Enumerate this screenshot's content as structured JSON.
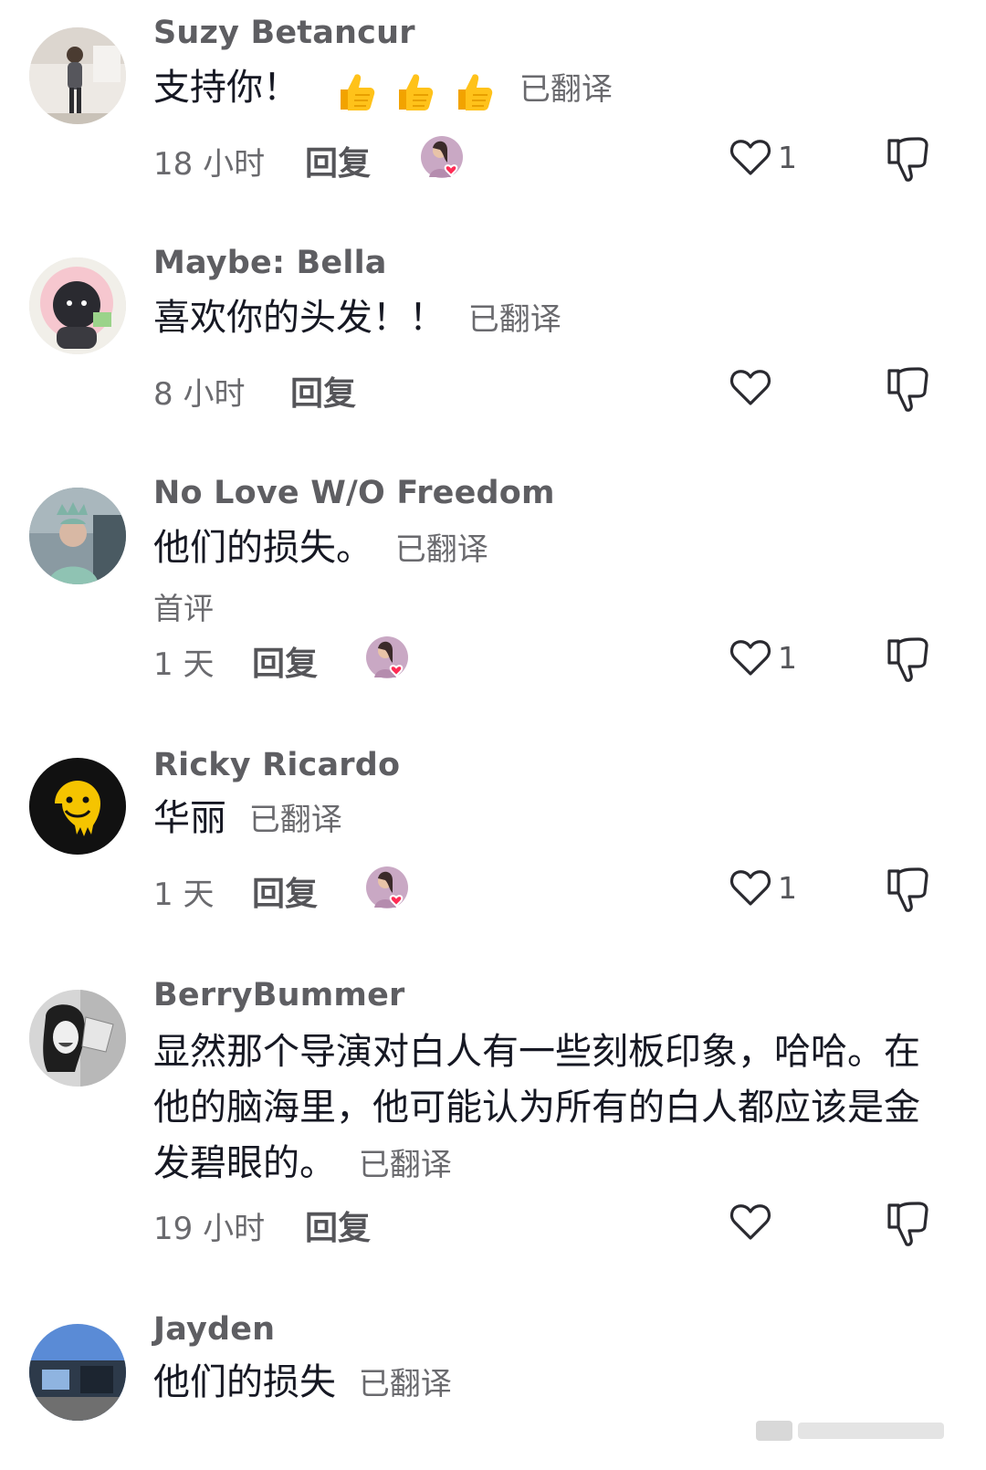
{
  "translated_label": "已翻译",
  "reply_label": "回复",
  "comments": [
    {
      "username": "Suzy Betancur",
      "text": "支持你！",
      "emoji": [
        "👍",
        "👍",
        "👍"
      ],
      "time": "18 小时",
      "likes": "1",
      "creator_liked": true
    },
    {
      "username": "Maybe: Bella",
      "text": "喜欢你的头发！！",
      "time": "8 小时",
      "likes": "",
      "creator_liked": false
    },
    {
      "username": "No Love W/O Freedom",
      "text": "他们的损失。",
      "tag": "首评",
      "time": "1 天",
      "likes": "1",
      "creator_liked": true
    },
    {
      "username": "Ricky Ricardo",
      "text": "华丽",
      "time": "1 天",
      "likes": "1",
      "creator_liked": true
    },
    {
      "username": "BerryBummer",
      "text": "显然那个导演对白人有一些刻板印象，哈哈。在他的脑海里，他可能认为所有的白人都应该是金发碧眼的。",
      "time": "19 小时",
      "likes": "",
      "creator_liked": false
    },
    {
      "username": "Jayden",
      "text": "他们的损失",
      "time": "",
      "likes": "",
      "creator_liked": false
    }
  ],
  "colors": {
    "heart_badge": "#fe2c55",
    "text_primary": "#161823",
    "text_secondary": "#6a6a6e"
  }
}
